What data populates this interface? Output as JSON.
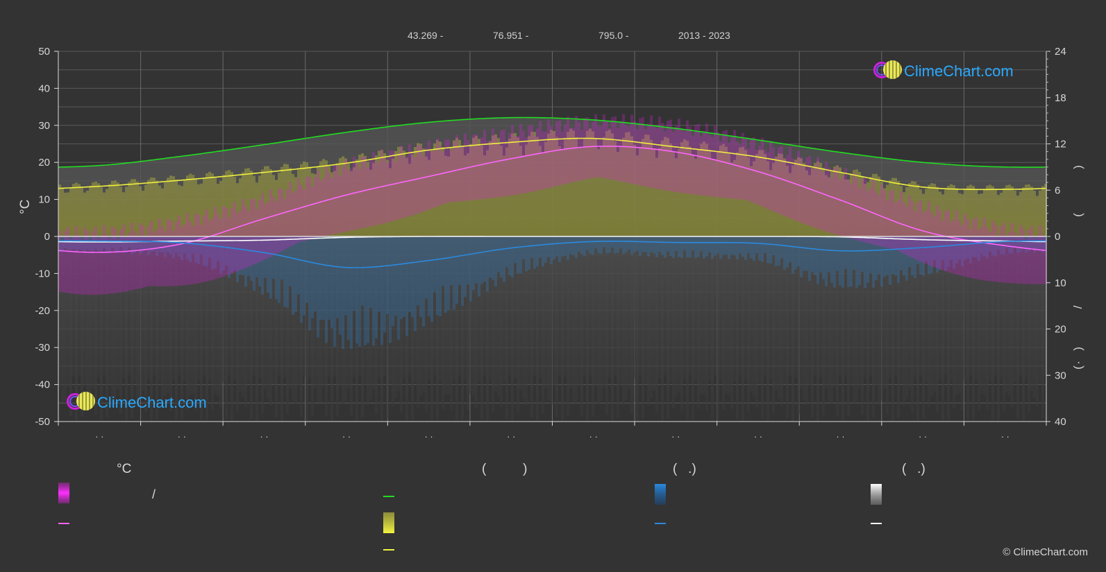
{
  "header": {
    "latitude": "43.269 -",
    "longitude": "76.951 -",
    "elevation": "795.0 -",
    "years": "2013 - 2023"
  },
  "logo_text": "ClimeChart.com",
  "copyright": "© ClimeChart.com",
  "legend": {
    "col1_head": "°C",
    "col1_slash": "/",
    "col2_head": "(          )",
    "col3_head": "(   .)",
    "col4_head": "(   .)"
  },
  "colors": {
    "background": "#333333",
    "daylight": "#22dd22",
    "sunshine": "#f0f040",
    "mean_temp": "#ff66ff",
    "rain": "#2a8ae0",
    "snow": "#ffffff",
    "temp_band": "#e020e0",
    "sun_band": "#c8c840"
  },
  "chart_data": {
    "type": "line",
    "x": [
      1,
      2,
      3,
      4,
      5,
      6,
      7,
      8,
      9,
      10,
      11,
      12
    ],
    "x_tick_labels": [
      "· ·",
      "· ·",
      "· ·",
      "· ·",
      "· ·",
      "· ·",
      "· ·",
      "· ·",
      "· ·",
      "· ·",
      "· ·",
      "· ·"
    ],
    "left_axis": {
      "label": "°C",
      "ylim": [
        -50,
        50
      ],
      "ticks": [
        50,
        40,
        30,
        20,
        10,
        0,
        -10,
        -20,
        -30,
        -40,
        -50
      ]
    },
    "right_axis_top": {
      "ylim": [
        0,
        24
      ],
      "ticks": [
        24,
        18,
        12,
        6,
        0
      ]
    },
    "right_axis_bottom": {
      "ylim": [
        0,
        40
      ],
      "ticks": [
        0,
        10,
        20,
        30,
        40
      ]
    },
    "right_axis_label_glyphs": [
      ")",
      "(",
      "/",
      ")",
      "·",
      "("
    ],
    "series": [
      {
        "key": "daylight",
        "axis": "hours",
        "values": [
          9.2,
          10.4,
          11.9,
          13.5,
          14.8,
          15.4,
          15.1,
          14.0,
          12.5,
          10.9,
          9.6,
          9.0
        ]
      },
      {
        "key": "sunshine",
        "axis": "hours",
        "values": [
          6.5,
          7.3,
          8.3,
          9.5,
          11.2,
          12.2,
          12.7,
          11.6,
          10.3,
          8.3,
          6.4,
          6.1
        ]
      },
      {
        "key": "mean_temp",
        "axis": "celsius",
        "values": [
          -4.3,
          -2.0,
          4.8,
          11.2,
          16.2,
          21.0,
          24.3,
          22.8,
          17.5,
          9.8,
          1.5,
          -2.5
        ]
      },
      {
        "key": "rain",
        "axis": "mm",
        "values": [
          1.0,
          1.4,
          3.5,
          6.7,
          5.2,
          2.5,
          1.1,
          1.3,
          1.5,
          3.1,
          2.4,
          1.1
        ]
      },
      {
        "key": "snow",
        "axis": "mm",
        "values": [
          1.2,
          1.0,
          0.8,
          0.2,
          0.0,
          0.0,
          0.0,
          0.0,
          0.0,
          0.1,
          0.7,
          1.0
        ]
      }
    ],
    "temp_range": {
      "max": [
        1,
        4,
        10,
        19,
        24,
        28,
        31,
        30,
        25,
        17,
        8,
        2
      ],
      "min": [
        -14,
        -12,
        -5,
        3,
        8,
        13,
        16,
        14,
        9,
        2,
        -6,
        -11
      ]
    },
    "grid": true,
    "legend_position": "bottom"
  }
}
